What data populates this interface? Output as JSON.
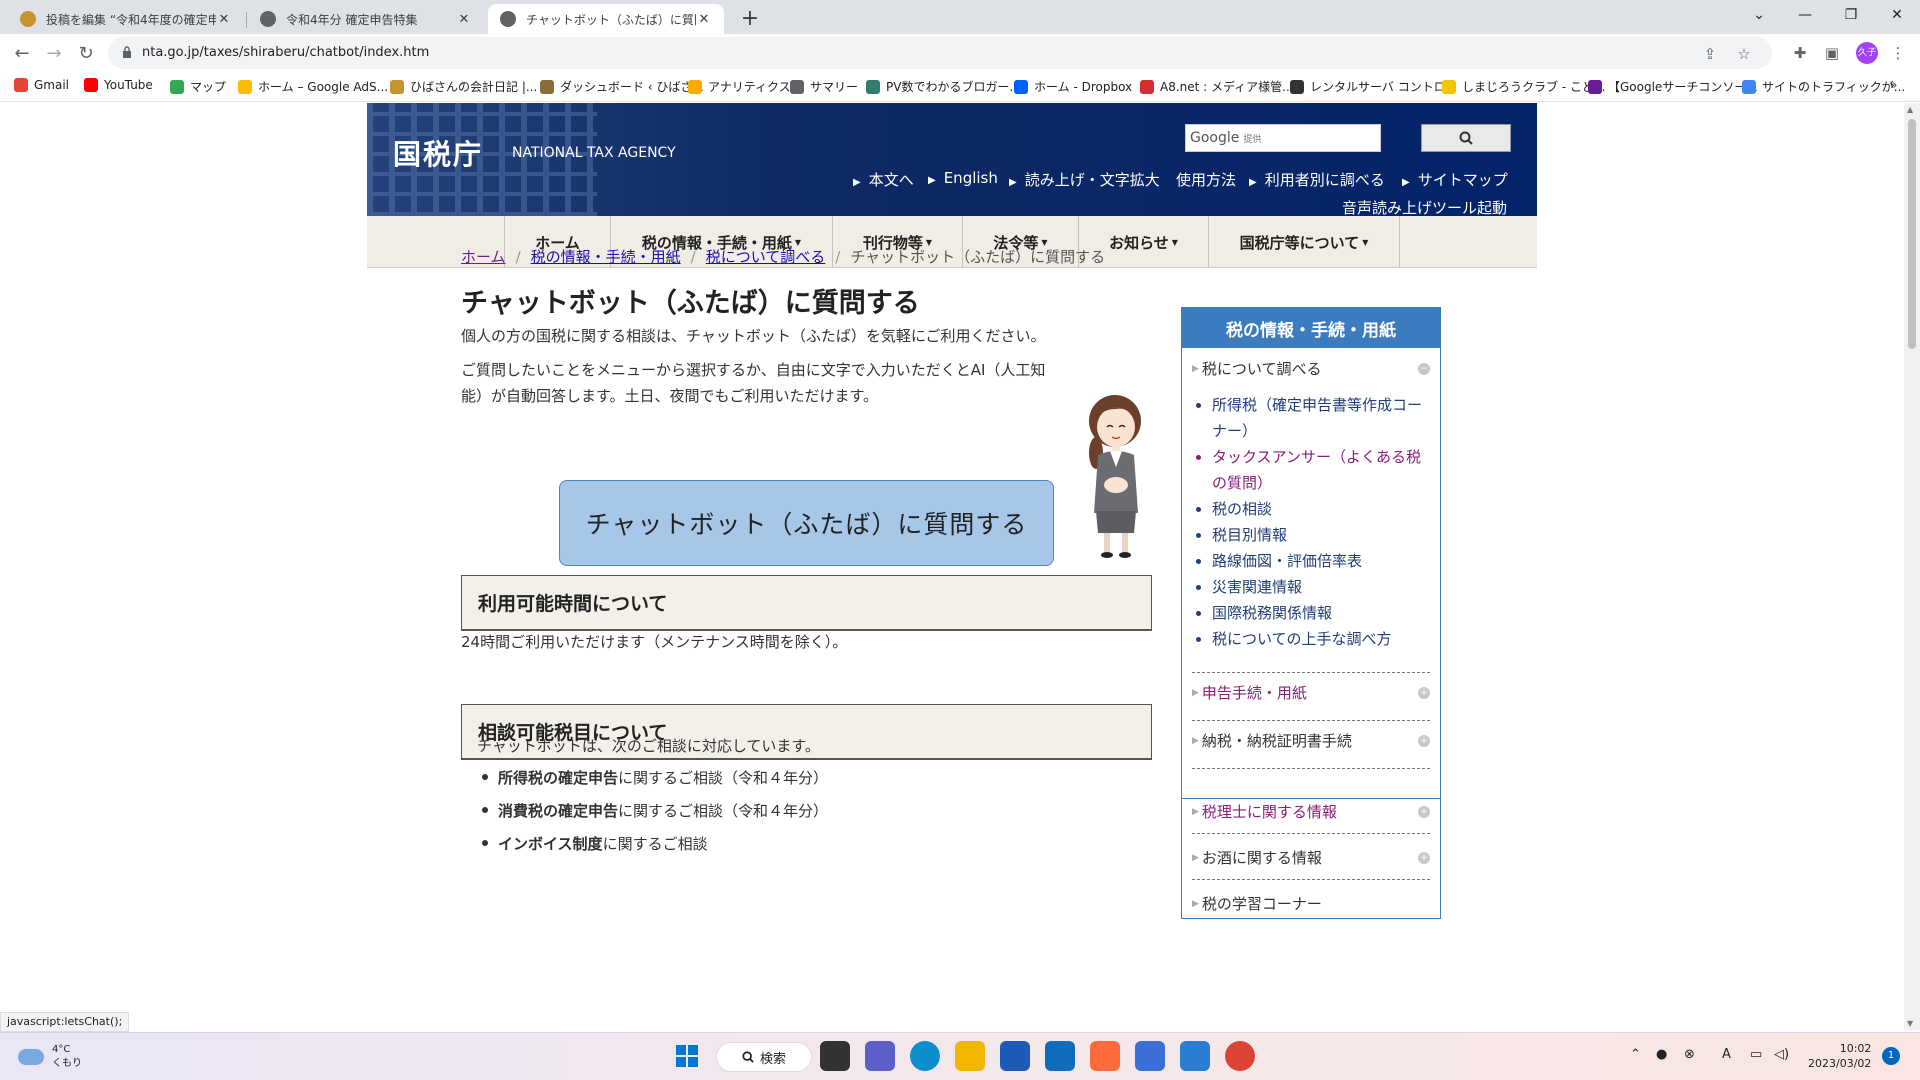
{
  "browser": {
    "tabs": [
      {
        "title": "投稿を編集 “令和4年度の確定申告"
      },
      {
        "title": "令和4年分 確定申告特集"
      },
      {
        "title": "チャットボット（ふたば）に質問する"
      }
    ],
    "url": "nta.go.jp/taxes/shiraberu/chatbot/index.htm",
    "profile_initial": "久子",
    "bookmarks": [
      {
        "label": "Gmail",
        "color": "#ea4335"
      },
      {
        "label": "YouTube",
        "color": "#ff0000"
      },
      {
        "label": "マップ",
        "color": "#34a853"
      },
      {
        "label": "ホーム – Google AdS...",
        "color": "#fbbc04"
      },
      {
        "label": "ひばさんの会計日記 |...",
        "color": "#c6942e"
      },
      {
        "label": "ダッシュボード ‹ ひばさ...",
        "color": "#8a6d3b"
      },
      {
        "label": "アナリティクス",
        "color": "#f9ab00"
      },
      {
        "label": "サマリー",
        "color": "#5f6368"
      },
      {
        "label": "PV数でわかるブロガー...",
        "color": "#2e7d6e"
      },
      {
        "label": "ホーム - Dropbox",
        "color": "#0061ff"
      },
      {
        "label": "A8.net : メディア様管...",
        "color": "#d32f2f"
      },
      {
        "label": "レンタルサーバ コントロ...",
        "color": "#333333"
      },
      {
        "label": "しまじろうクラブ - こど...",
        "color": "#f5c400"
      },
      {
        "label": "【Googleサーチコンソー...",
        "color": "#6a1b9a"
      },
      {
        "label": "サイトのトラフィックが...",
        "color": "#4285f4"
      }
    ]
  },
  "header": {
    "logo_jp": "国税庁",
    "logo_en": "NATIONAL TAX AGENCY",
    "search_brand": "Google",
    "search_provided": "提供",
    "util_links": [
      "本文へ",
      "English",
      "読み上げ・文字拡大",
      "使用方法",
      "利用者別に調べる",
      "サイトマップ"
    ],
    "voice_tool": "音声読み上げツール起動"
  },
  "gnav": {
    "items": [
      "ホーム",
      "税の情報・手続・用紙",
      "刊行物等",
      "法令等",
      "お知らせ",
      "国税庁等について"
    ]
  },
  "breadcrumb": {
    "links": [
      "ホーム",
      "税の情報・手続・用紙",
      "税について調べる"
    ],
    "current": "チャットボット（ふたば）に質問する"
  },
  "main": {
    "title": "チャットボット（ふたば）に質問する",
    "intro1": "個人の方の国税に関する相談は、チャットボット（ふたば）を気軽にご利用ください。",
    "intro2a": "ご質問したいことをメニューから選択するか、自由に文字で入力いただくとAI（人工知",
    "intro2b": "能）が自動回答します。土日、夜間でもご利用いただけます。",
    "chat_button": "チャットボット（ふたば）に質問する",
    "section1_title": "利用可能時間について",
    "section1_body": "24時間ご利用いただけます（メンテナンス時間を除く）。",
    "section2_title": "相談可能税目について",
    "section2_intro": "チャットボットは、次のご相談に対応しています。",
    "section2_items": [
      {
        "bold": "所得税の確定申告",
        "rest": "に関するご相談（令和４年分）"
      },
      {
        "bold": "消費税の確定申告",
        "rest": "に関するご相談（令和４年分）"
      },
      {
        "bold": "インボイス制度",
        "rest": "に関するご相談"
      }
    ]
  },
  "sidenav": {
    "title": "税の情報・手続・用紙",
    "current_group": "税について調べる",
    "sub_items": [
      "所得税（確定申告書等作成コーナー）",
      "タックスアンサー（よくある税の質問）",
      "税の相談",
      "税目別情報",
      "路線価図・評価倍率表",
      "災害関連情報",
      "国際税務関係情報",
      "税についての上手な調べ方"
    ],
    "groups": [
      "申告手続・用紙",
      "納税・納税証明書手続",
      "税理士に関する情報",
      "お酒に関する情報",
      "税の学習コーナー"
    ]
  },
  "status_bar": "javascript:letsChat();",
  "taskbar": {
    "temp": "4°C",
    "weather": "くもり",
    "search_label": "検索",
    "time": "10:02",
    "date": "2023/03/02",
    "notifications": "1"
  }
}
